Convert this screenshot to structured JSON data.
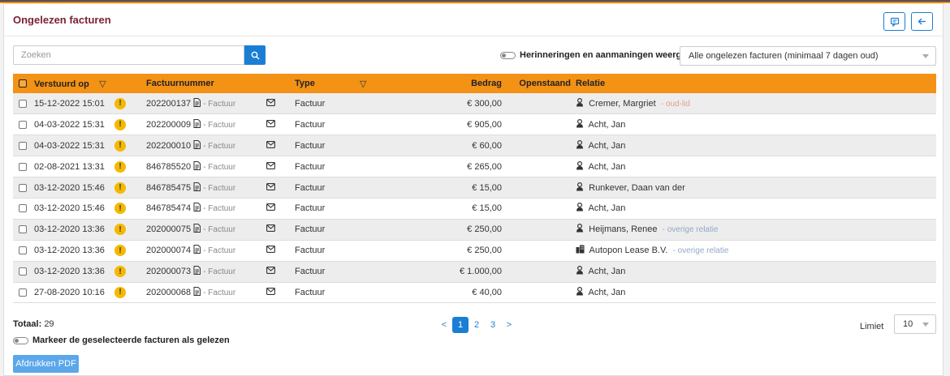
{
  "header": {
    "title": "Ongelezen facturen"
  },
  "search": {
    "placeholder": "Zoeken"
  },
  "toggle_label": "Herinneringen en aanmaningen weergeven",
  "filter_select": "Alle ongelezen facturen (minimaal 7 dagen oud)",
  "table": {
    "columns": [
      "Verstuurd op",
      "Factuurnummer",
      "Type",
      "Bedrag",
      "Openstaand",
      "Relatie"
    ],
    "rows": [
      {
        "date": "15-12-2022 15:01",
        "nummer": "202200137",
        "sub": "- Factuur",
        "type": "Factuur",
        "bedrag": "€ 300,00",
        "relatie": "Cremer, Margriet",
        "note": "- oud-lid",
        "note_kind": "red",
        "rel_icon": "person-icon"
      },
      {
        "date": "04-03-2022 15:31",
        "nummer": "202200009",
        "sub": "- Factuur",
        "type": "Factuur",
        "bedrag": "€ 905,00",
        "relatie": "Acht, Jan",
        "note": "",
        "note_kind": "",
        "rel_icon": "person-icon"
      },
      {
        "date": "04-03-2022 15:31",
        "nummer": "202200010",
        "sub": "- Factuur",
        "type": "Factuur",
        "bedrag": "€ 60,00",
        "relatie": "Acht, Jan",
        "note": "",
        "note_kind": "",
        "rel_icon": "person-icon"
      },
      {
        "date": "02-08-2021 13:31",
        "nummer": "846785520",
        "sub": "- Factuur",
        "type": "Factuur",
        "bedrag": "€ 265,00",
        "relatie": "Acht, Jan",
        "note": "",
        "note_kind": "",
        "rel_icon": "person-icon"
      },
      {
        "date": "03-12-2020 15:46",
        "nummer": "846785475",
        "sub": "- Factuur",
        "type": "Factuur",
        "bedrag": "€ 15,00",
        "relatie": "Runkever, Daan van der",
        "note": "",
        "note_kind": "",
        "rel_icon": "person-icon"
      },
      {
        "date": "03-12-2020 15:46",
        "nummer": "846785474",
        "sub": "- Factuur",
        "type": "Factuur",
        "bedrag": "€ 15,00",
        "relatie": "Acht, Jan",
        "note": "",
        "note_kind": "",
        "rel_icon": "person-icon"
      },
      {
        "date": "03-12-2020 13:36",
        "nummer": "202000075",
        "sub": "- Factuur",
        "type": "Factuur",
        "bedrag": "€ 250,00",
        "relatie": "Heijmans, Renee",
        "note": "- overige relatie",
        "note_kind": "blue",
        "rel_icon": "person-icon"
      },
      {
        "date": "03-12-2020 13:36",
        "nummer": "202000074",
        "sub": "- Factuur",
        "type": "Factuur",
        "bedrag": "€ 250,00",
        "relatie": "Autopon Lease B.V.",
        "note": "- overige relatie",
        "note_kind": "blue",
        "rel_icon": "building-icon"
      },
      {
        "date": "03-12-2020 13:36",
        "nummer": "202000073",
        "sub": "- Factuur",
        "type": "Factuur",
        "bedrag": "€ 1.000,00",
        "relatie": "Acht, Jan",
        "note": "",
        "note_kind": "",
        "rel_icon": "person-icon"
      },
      {
        "date": "27-08-2020 10:16",
        "nummer": "202000068",
        "sub": "- Factuur",
        "type": "Factuur",
        "bedrag": "€ 40,00",
        "relatie": "Acht, Jan",
        "note": "",
        "note_kind": "",
        "rel_icon": "person-icon"
      }
    ]
  },
  "footer": {
    "totaal_label": "Totaal:",
    "totaal_value": "29",
    "mark_label": "Markeer de geselecteerde facturen als gelezen",
    "pdf_button": "Afdrukken PDF",
    "pagination": {
      "prev": "<",
      "pages": [
        "1",
        "2",
        "3"
      ],
      "active": "1",
      "next": ">"
    },
    "limiet_label": "Limiet",
    "limiet_value": "10"
  },
  "warn_glyph": "!",
  "colors": {
    "accent": "#1a7fd4",
    "header_bg": "#f39214",
    "title": "#7b2235",
    "warn": "#f5b800"
  }
}
